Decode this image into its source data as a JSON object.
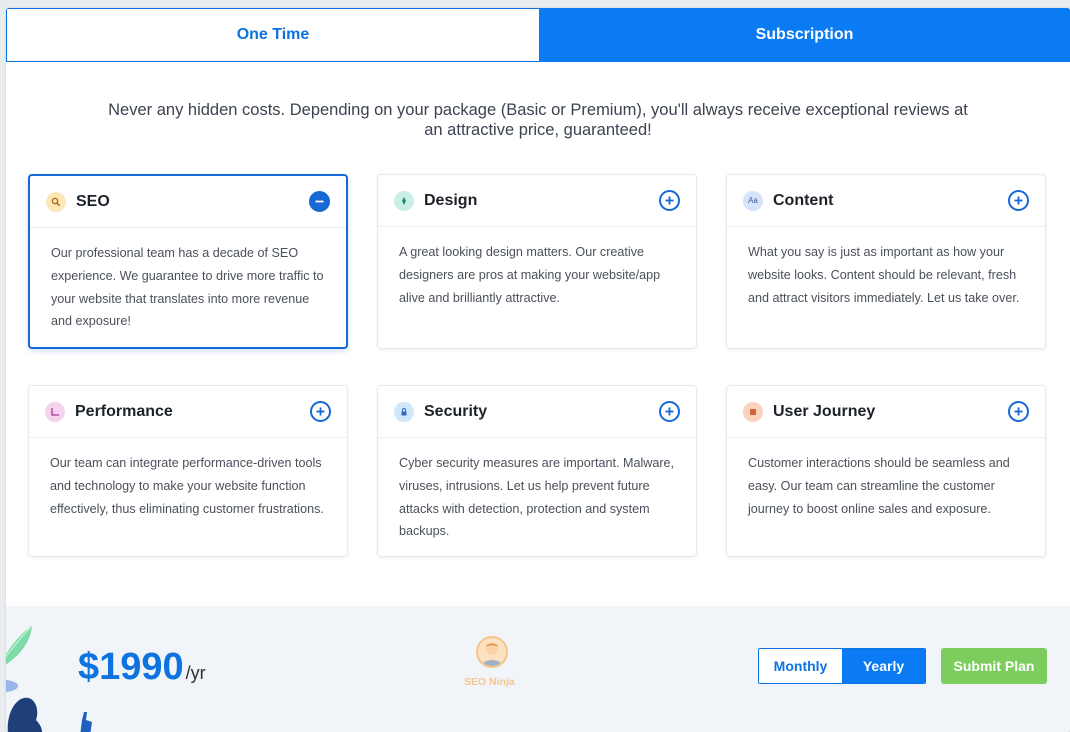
{
  "tabs": {
    "one_time": "One Time",
    "subscription": "Subscription"
  },
  "intro": "Never any hidden costs. Depending on your package (Basic or Premium), you'll always receive exceptional reviews at an attractive price, guaranteed!",
  "cards": [
    {
      "title": "SEO",
      "icon": "magnifier-icon",
      "expanded": true,
      "body": "Our professional team has a decade of SEO experience. We guarantee to drive more traffic to your website that translates into more revenue and exposure!"
    },
    {
      "title": "Design",
      "icon": "pen-icon",
      "expanded": false,
      "body": "A great looking design matters. Our creative designers are pros at making your website/app alive and brilliantly attractive."
    },
    {
      "title": "Content",
      "icon": "text-icon",
      "expanded": false,
      "body": "What you say is just as important as how your website looks. Content should be relevant, fresh and attract visitors immediately. Let us take over."
    },
    {
      "title": "Performance",
      "icon": "chart-icon",
      "expanded": false,
      "body": "Our team can integrate performance-driven tools and technology to make your website function effectively, thus eliminating customer frustrations."
    },
    {
      "title": "Security",
      "icon": "lock-icon",
      "expanded": false,
      "body": "Cyber security measures are important. Malware, viruses, intrusions. Let us help prevent future attacks with detection, protection and system backups."
    },
    {
      "title": "User Journey",
      "icon": "journey-icon",
      "expanded": false,
      "body": "Customer interactions should be seamless and easy. Our team can streamline the customer journey to boost online sales and exposure."
    }
  ],
  "footer": {
    "price": "$1990",
    "period": "/yr",
    "persona_label": "SEO Ninja",
    "billing": {
      "monthly": "Monthly",
      "yearly": "Yearly",
      "selected": "Yearly"
    },
    "submit": "Submit Plan"
  },
  "colors": {
    "accent": "#0a7bf2",
    "active_border": "#1668d6",
    "submit": "#7dcd5e",
    "persona": "#f3c68e"
  }
}
